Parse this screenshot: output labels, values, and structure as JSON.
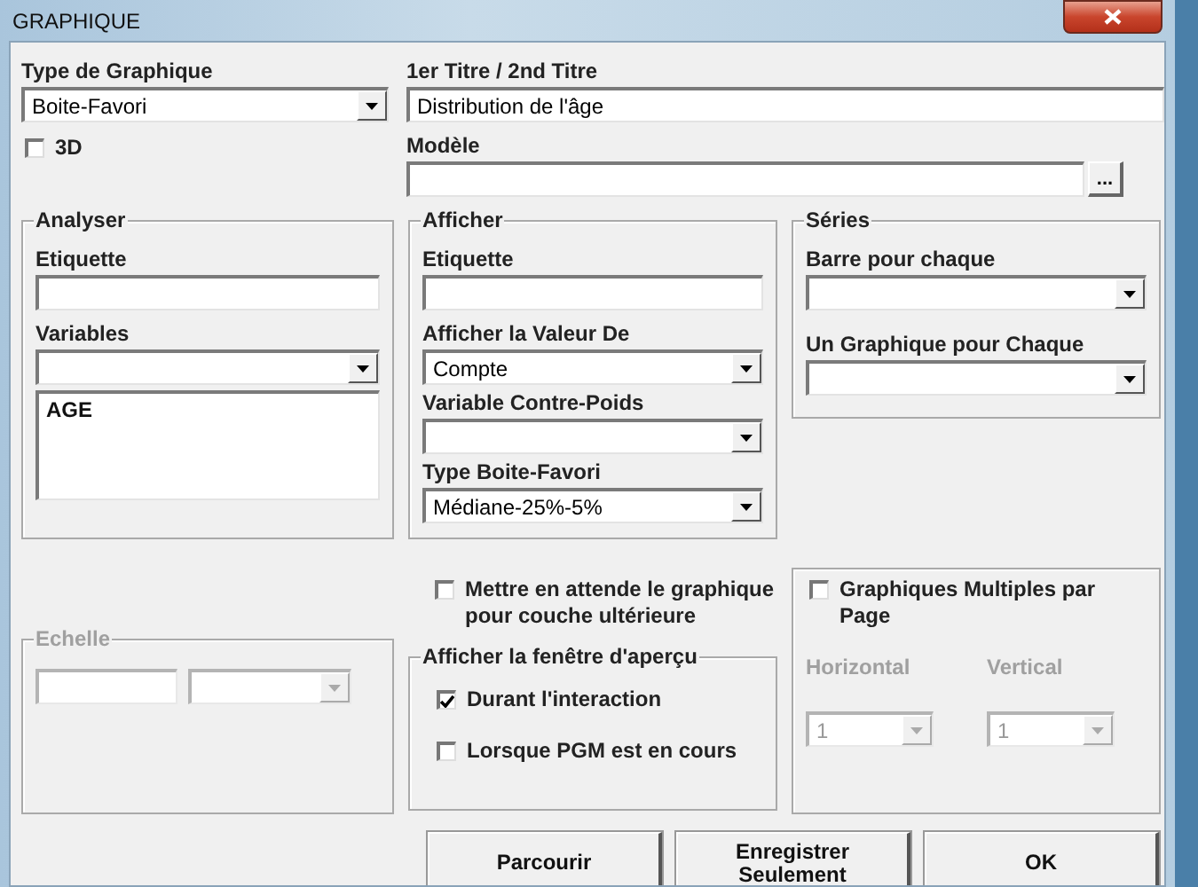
{
  "window": {
    "title": "GRAPHIQUE"
  },
  "chart_type": {
    "label": "Type de Graphique",
    "value": "Boite-Favori"
  },
  "three_d": {
    "label": "3D",
    "checked": false
  },
  "titles": {
    "label": "1er Titre / 2nd Titre",
    "value": "Distribution de l'âge"
  },
  "template": {
    "label": "Modèle",
    "browse": "..."
  },
  "analyser": {
    "title": "Analyser",
    "label_field": {
      "label": "Etiquette"
    },
    "variables": {
      "label": "Variables",
      "list": [
        "AGE"
      ]
    }
  },
  "afficher": {
    "title": "Afficher",
    "label_field": {
      "label": "Etiquette"
    },
    "value_of": {
      "label": "Afficher la Valeur De",
      "value": "Compte"
    },
    "weight": {
      "label": "Variable Contre-Poids"
    },
    "box_type": {
      "label": "Type Boite-Favori",
      "value": "Médiane-25%-5%"
    }
  },
  "series": {
    "title": "Séries",
    "bar_each": {
      "label": "Barre pour chaque"
    },
    "chart_each": {
      "label": "Un Graphique pour Chaque"
    }
  },
  "hold": {
    "label": "Mettre en attende le graphique pour couche ultérieure",
    "checked": false
  },
  "scale": {
    "title": "Echelle",
    "disabled": true
  },
  "preview": {
    "title": "Afficher la fenêtre d'aperçu",
    "options": [
      {
        "label": "Durant l'interaction",
        "checked": true
      },
      {
        "label": "Lorsque PGM est en cours",
        "checked": false
      }
    ]
  },
  "multiple": {
    "label": "Graphiques Multiples par Page",
    "checked": false,
    "horizontal": {
      "label": "Horizontal",
      "value": "1",
      "disabled": true
    },
    "vertical": {
      "label": "Vertical",
      "value": "1",
      "disabled": true
    }
  },
  "buttons": [
    "Parcourir",
    "Enregistrer Seulement",
    "OK"
  ]
}
